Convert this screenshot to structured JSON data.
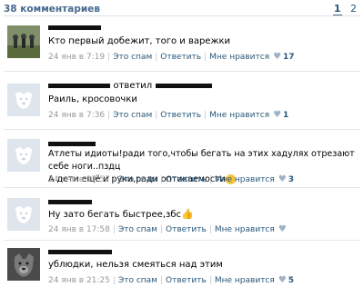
{
  "header": {
    "count_label": "38 комментариев",
    "pages": [
      "1",
      "2"
    ],
    "active_page": "1"
  },
  "comments": [
    {
      "author": "",
      "reply_label": "",
      "text": "Кто первый добежит, того и варежки",
      "date": "24 янв в 7:19",
      "spam": "Это спам",
      "reply": "Ответить",
      "like": "Мне нравится",
      "likes": "17",
      "avatar_icon": "user-photo-icon"
    },
    {
      "author": "",
      "reply_label": "ответил",
      "text": "Раиль, кросовочки",
      "date": "24 янв в 7:36",
      "spam": "Это спам",
      "reply": "Ответить",
      "like": "Мне нравится",
      "likes": "1",
      "avatar_icon": "default-dog-avatar-icon"
    },
    {
      "author": "",
      "reply_label": "",
      "text": "Атлеты идиоты!ради того,чтобы бегать на этих хадулях отрезают себе ноги..пздц",
      "text2": "А дети ещё и руки,ради оптикаемости",
      "date": "24 янв в 17:57",
      "spam": "Это спам",
      "reply": "Ответить",
      "like": "Мне нравится",
      "likes": "3",
      "avatar_icon": "default-dog-avatar-icon"
    },
    {
      "author": "",
      "reply_label": "",
      "text": "Ну зато бегать быстрее,збс",
      "date": "24 янв в 17:58",
      "spam": "Это спам",
      "reply": "Ответить",
      "like": "Мне нравится",
      "likes": "",
      "avatar_icon": "default-dog-avatar-icon"
    },
    {
      "author": "",
      "reply_label": "",
      "text": "ублюдки, нельзя смеяться над этим",
      "date": "24 янв в 21:25",
      "spam": "Это спам",
      "reply": "Ответить",
      "like": "Мне нравится",
      "likes": "5",
      "avatar_icon": "dog-photo-icon"
    }
  ]
}
